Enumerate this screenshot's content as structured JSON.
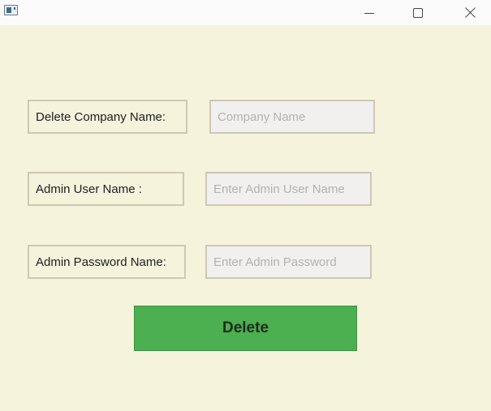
{
  "window": {
    "icon": "app-window-icon",
    "controls": {
      "minimize_icon": "minimize-icon",
      "maximize_icon": "maximize-icon",
      "close_icon": "close-icon"
    }
  },
  "form": {
    "company": {
      "label": "Delete Company Name:",
      "placeholder": "Company Name",
      "value": ""
    },
    "admin_user": {
      "label": "Admin User Name :",
      "placeholder": "Enter Admin User Name",
      "value": ""
    },
    "admin_password": {
      "label": "Admin Password Name:",
      "placeholder": "Enter Admin Password",
      "value": ""
    },
    "delete_button": {
      "label": "Delete"
    }
  },
  "colors": {
    "background": "#f5f3dc",
    "button": "#4caf50",
    "titlebar": "#fbfbfb"
  }
}
